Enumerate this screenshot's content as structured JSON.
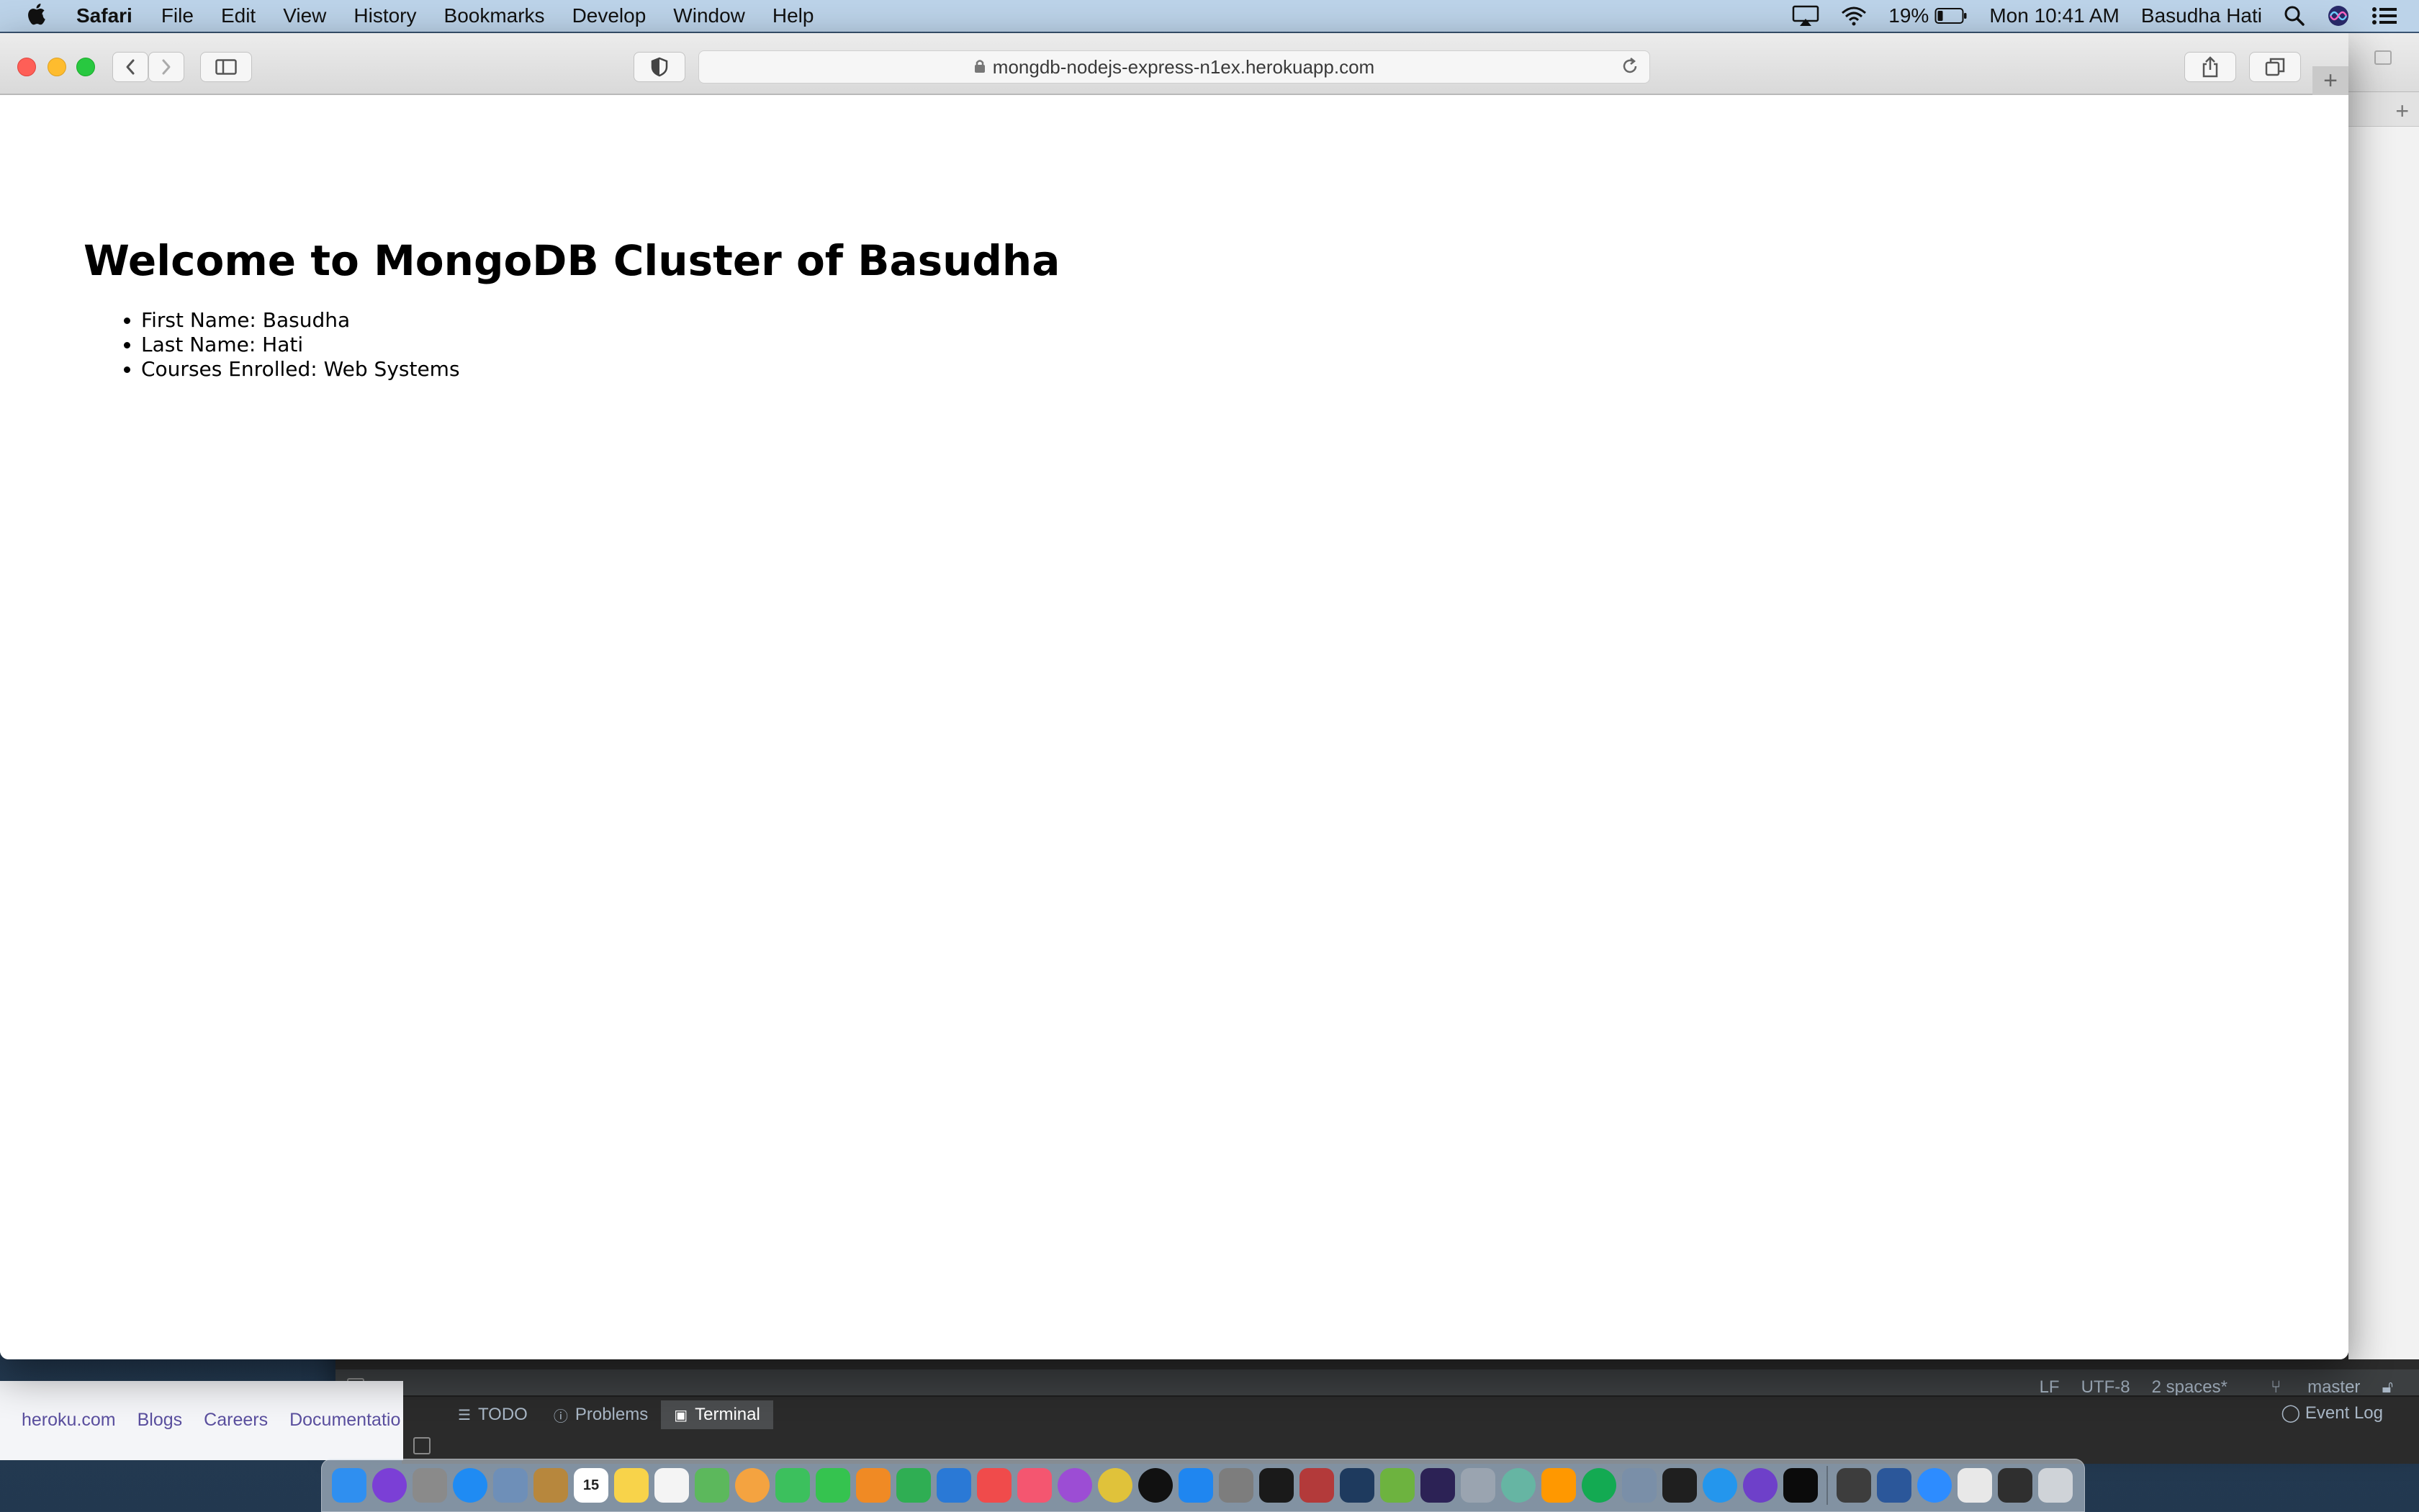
{
  "menubar": {
    "app_name": "Safari",
    "items": [
      "File",
      "Edit",
      "View",
      "History",
      "Bookmarks",
      "Develop",
      "Window",
      "Help"
    ],
    "battery": "19%",
    "clock": "Mon 10:41 AM",
    "user": "Basudha Hati"
  },
  "browser": {
    "url": "mongdb-nodejs-express-n1ex.herokuapp.com"
  },
  "page": {
    "heading": "Welcome to MongoDB Cluster of Basudha",
    "items": [
      "First Name: Basudha",
      "Last Name: Hati",
      "Courses Enrolled: Web Systems"
    ]
  },
  "ide": {
    "status": {
      "line_ending": "LF",
      "encoding": "UTF-8",
      "indent": "2 spaces*",
      "branch": "master"
    },
    "tabs": [
      "TODO",
      "Problems",
      "Terminal"
    ],
    "active_tab": "Terminal",
    "event_log": "Event Log"
  },
  "heroku_footer": {
    "links": [
      "heroku.com",
      "Blogs",
      "Careers",
      "Documentatio"
    ]
  },
  "dock": {
    "calendar_day": "15",
    "apps": [
      {
        "name": "finder",
        "color": "#2f8ff0"
      },
      {
        "name": "siri",
        "color": "#7b3fd6"
      },
      {
        "name": "launchpad",
        "color": "#8a8a8a"
      },
      {
        "name": "safari",
        "color": "#1f8bf3"
      },
      {
        "name": "preview",
        "color": "#6e8fb8"
      },
      {
        "name": "notes-folder",
        "color": "#b7873d"
      },
      {
        "name": "calendar",
        "color": "#ffffff"
      },
      {
        "name": "notes",
        "color": "#f8d34a"
      },
      {
        "name": "reminders",
        "color": "#f4f4f4"
      },
      {
        "name": "maps",
        "color": "#5cb85c"
      },
      {
        "name": "photos",
        "color": "#f4a340"
      },
      {
        "name": "messages",
        "color": "#3cc05d"
      },
      {
        "name": "facetime",
        "color": "#35c34f"
      },
      {
        "name": "pages",
        "color": "#f08a24"
      },
      {
        "name": "numbers",
        "color": "#2fae53"
      },
      {
        "name": "keynote",
        "color": "#2a79d6"
      },
      {
        "name": "news",
        "color": "#f04b4b"
      },
      {
        "name": "music",
        "color": "#f45670"
      },
      {
        "name": "podcasts",
        "color": "#9c4dd4"
      },
      {
        "name": "chrome",
        "color": "#e0c23a"
      },
      {
        "name": "apple-tv",
        "color": "#111111"
      },
      {
        "name": "app-store",
        "color": "#1f86f0"
      },
      {
        "name": "system-preferences",
        "color": "#7d7d7d"
      },
      {
        "name": "terminal",
        "color": "#1a1a1a"
      },
      {
        "name": "dictionary",
        "color": "#b33a3a"
      },
      {
        "name": "mysql-workbench",
        "color": "#1e3a5e"
      },
      {
        "name": "spring-tools",
        "color": "#6db33f"
      },
      {
        "name": "eclipse",
        "color": "#2c2255"
      },
      {
        "name": "bbedit",
        "color": "#9aa4b0"
      },
      {
        "name": "atom",
        "color": "#66b5a3"
      },
      {
        "name": "sublime",
        "color": "#ff9800"
      },
      {
        "name": "mongodb",
        "color": "#13aa52"
      },
      {
        "name": "image-capture",
        "color": "#7a8fa8"
      },
      {
        "name": "pycharm",
        "color": "#1f1f1f"
      },
      {
        "name": "docker",
        "color": "#2496ed"
      },
      {
        "name": "github",
        "color": "#6e40c9"
      },
      {
        "name": "webstorm",
        "color": "#0b0b0b"
      },
      {
        "name": "zoom-tool",
        "color": "#3d3d3d"
      },
      {
        "name": "word",
        "color": "#2b579a"
      },
      {
        "name": "zoom",
        "color": "#2d8cff"
      },
      {
        "name": "document",
        "color": "#e8e8e8"
      },
      {
        "name": "screen",
        "color": "#2f2f2f"
      },
      {
        "name": "trash",
        "color": "#cfd3d8"
      }
    ]
  }
}
